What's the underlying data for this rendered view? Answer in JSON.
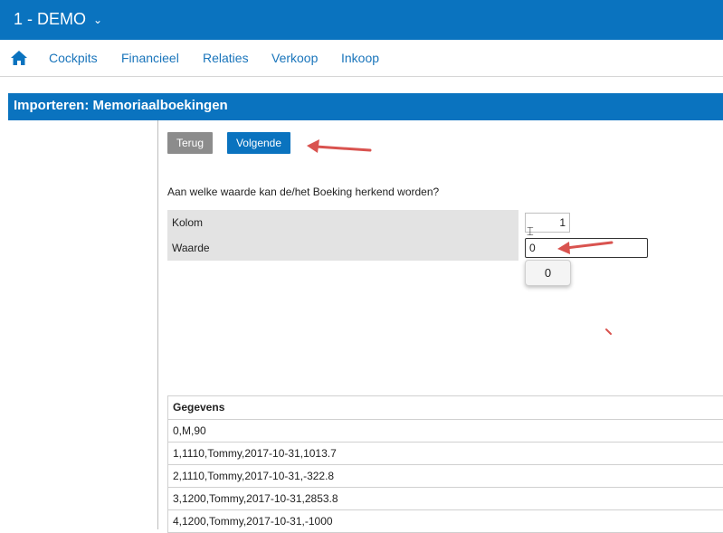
{
  "header": {
    "company": "1 - DEMO",
    "company_icon": "chevron-down-icon"
  },
  "nav": {
    "home_icon": "home-icon",
    "items": [
      {
        "label": "Cockpits"
      },
      {
        "label": "Financieel"
      },
      {
        "label": "Relaties"
      },
      {
        "label": "Verkoop"
      },
      {
        "label": "Inkoop"
      }
    ]
  },
  "page": {
    "title": "Importeren: Memoriaalboekingen"
  },
  "actions": {
    "back_label": "Terug",
    "next_label": "Volgende"
  },
  "form": {
    "question": "Aan welke waarde kan de/het Boeking herkend worden?",
    "kolom_label": "Kolom",
    "kolom_value": "1",
    "waarde_label": "Waarde",
    "waarde_value": "0",
    "suggestion": "0"
  },
  "table": {
    "header": "Gegevens",
    "rows": [
      "0,M,90",
      "1,1110,Tommy,2017-10-31,1013.7",
      "2,1110,Tommy,2017-10-31,-322.8",
      "3,1200,Tommy,2017-10-31,2853.8",
      "4,1200,Tommy,2017-10-31,-1000"
    ]
  },
  "colors": {
    "brand": "#0a73bf",
    "link": "#1a75bb",
    "annotation": "#d9534f"
  }
}
